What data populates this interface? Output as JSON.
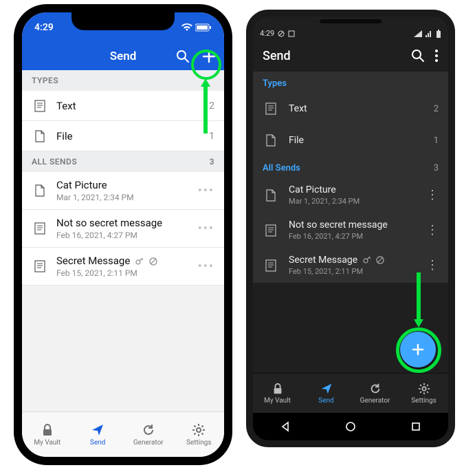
{
  "ios": {
    "status": {
      "time": "4:29",
      "wifi": "wifi",
      "battery": "battery"
    },
    "header": {
      "title": "Send"
    },
    "sections": {
      "types": {
        "label": "TYPES",
        "items": [
          {
            "icon": "text-icon",
            "label": "Text",
            "count": "2"
          },
          {
            "icon": "file-icon",
            "label": "File",
            "count": "1"
          }
        ]
      },
      "all": {
        "label": "ALL SENDS",
        "count": "3",
        "items": [
          {
            "icon": "file-icon",
            "title": "Cat Picture",
            "sub": "Mar 1, 2021, 2:34 PM",
            "key": false,
            "disabled": false
          },
          {
            "icon": "text-icon",
            "title": "Not so secret message",
            "sub": "Feb 16, 2021, 4:27 PM",
            "key": false,
            "disabled": false
          },
          {
            "icon": "text-icon",
            "title": "Secret Message",
            "sub": "Feb 15, 2021, 2:11 PM",
            "key": true,
            "disabled": true
          }
        ]
      }
    },
    "tabs": [
      {
        "icon": "lock",
        "label": "My Vault"
      },
      {
        "icon": "send",
        "label": "Send",
        "active": true
      },
      {
        "icon": "refresh",
        "label": "Generator"
      },
      {
        "icon": "gear",
        "label": "Settings"
      }
    ]
  },
  "android": {
    "status": {
      "time": "4:29"
    },
    "header": {
      "title": "Send"
    },
    "sections": {
      "types": {
        "label": "Types",
        "items": [
          {
            "icon": "text-icon",
            "label": "Text",
            "count": "2"
          },
          {
            "icon": "file-icon",
            "label": "File",
            "count": "1"
          }
        ]
      },
      "all": {
        "label": "All Sends",
        "count": "3",
        "items": [
          {
            "icon": "file-icon",
            "title": "Cat Picture",
            "sub": "Mar 1, 2021, 2:34 PM",
            "key": false,
            "disabled": false
          },
          {
            "icon": "text-icon",
            "title": "Not so secret message",
            "sub": "Feb 16, 2021, 4:27 PM",
            "key": false,
            "disabled": false
          },
          {
            "icon": "text-icon",
            "title": "Secret Message",
            "sub": "Feb 15, 2021, 2:11 PM",
            "key": true,
            "disabled": true
          }
        ]
      }
    },
    "tabs": [
      {
        "icon": "lock",
        "label": "My Vault"
      },
      {
        "icon": "send",
        "label": "Send",
        "active": true
      },
      {
        "icon": "refresh",
        "label": "Generator"
      },
      {
        "icon": "gear",
        "label": "Settings"
      }
    ]
  }
}
